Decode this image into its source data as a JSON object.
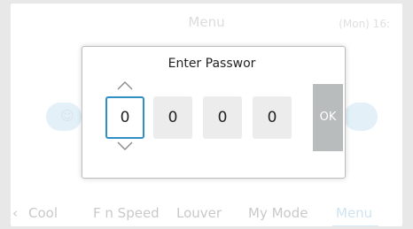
{
  "header": {
    "title": "Menu",
    "clock": "(Mon) 16:"
  },
  "nav": {
    "items": [
      {
        "label": "Cool"
      },
      {
        "label": "F n Speed"
      },
      {
        "label": "Louver"
      },
      {
        "label": "My Mode"
      },
      {
        "label": "Menu"
      }
    ],
    "active_index": 4
  },
  "background_icon": "user-icon",
  "dialog": {
    "title": "Enter Passwor",
    "digits": [
      "0",
      "0",
      "0",
      "0"
    ],
    "selected_digit_index": 0,
    "ok_label": "OK"
  },
  "colors": {
    "accent": "#2f8fc6",
    "ok_button": "#b9bcbd",
    "digit_background": "#ececec"
  }
}
